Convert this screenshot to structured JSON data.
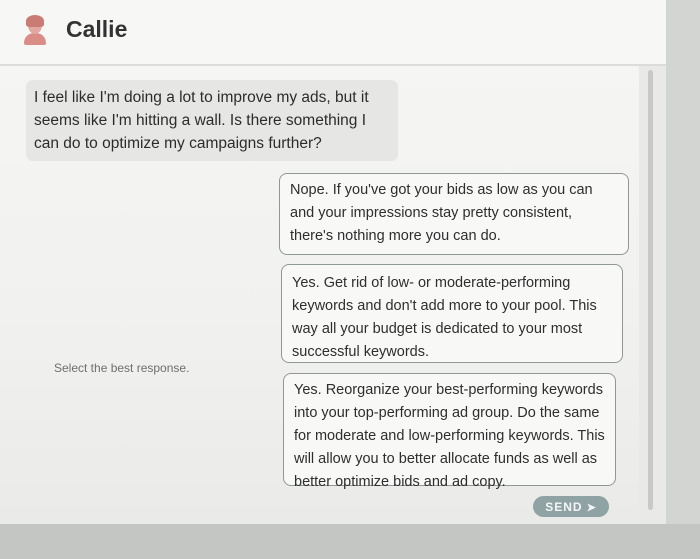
{
  "header": {
    "contact_name": "Callie",
    "avatar_icon": "person-avatar-icon"
  },
  "conversation": {
    "message": "I feel like I'm doing a lot to improve my ads, but it seems like I'm hitting a wall. Is there something I can do to optimize my campaigns further?"
  },
  "response_prompt": "Select the best response.",
  "options": [
    {
      "text": "Nope. If you've got your bids as low as you can and your impressions stay pretty consistent, there's nothing more you can do."
    },
    {
      "text": "Yes. Get rid of low- or moderate-performing keywords and don't add more to your pool. This way all your budget is dedicated to your most successful keywords."
    },
    {
      "text": "Yes. Reorganize your best-performing keywords into your top-performing ad group. Do the same for moderate and low-performing keywords. This will allow you to better allocate funds as well as better optimize bids and ad copy."
    }
  ],
  "actions": {
    "send_label": "SEND",
    "send_icon": "arrow-right-icon"
  },
  "colors": {
    "send_button": "#8fa2a4",
    "option_border": "#8f9896",
    "message_bubble": "#e6e6e4"
  }
}
